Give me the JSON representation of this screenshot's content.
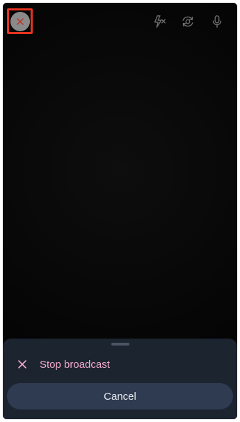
{
  "top_bar": {
    "close_icon": "close-icon",
    "flash_icon": "flash-off-icon",
    "switch_camera_icon": "switch-camera-icon",
    "mic_icon": "microphone-icon",
    "close_highlight_color": "#e5331f"
  },
  "sheet": {
    "stop_icon": "x-icon",
    "stop_label": "Stop broadcast",
    "stop_label_color": "#f2aacb",
    "cancel_label": "Cancel"
  }
}
